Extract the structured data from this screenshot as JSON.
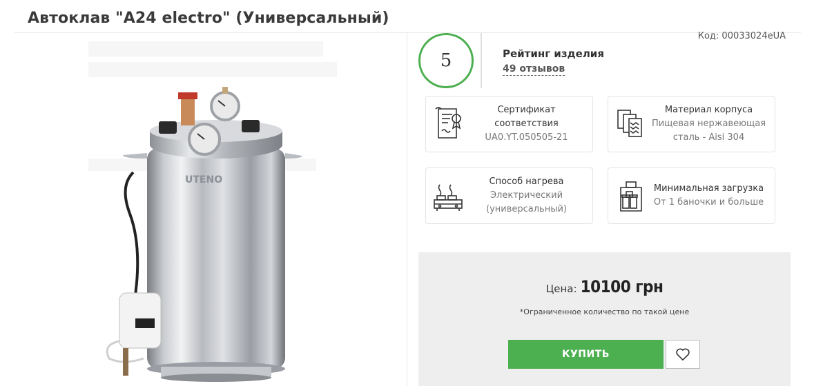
{
  "product": {
    "title": "Автоклав \"A24 electro\" (Универсальный)",
    "code": "Код: 00033024eUA",
    "image_logo_text": "UTENO"
  },
  "rating": {
    "value": "5",
    "title": "Рейтинг изделия",
    "reviews": "49 отзывов"
  },
  "features": [
    {
      "icon": "certificate-icon",
      "label": "Сертификат соответствия",
      "value": "UA0.YT.050505-21"
    },
    {
      "icon": "material-icon",
      "label": "Материал корпуса",
      "value": "Пищевая нержавеющая сталь - Aisi 304"
    },
    {
      "icon": "stove-icon",
      "label": "Способ нагрева",
      "value": "Электрический (универсальный)"
    },
    {
      "icon": "jars-icon",
      "label": "Минимальная загрузка",
      "value": "От 1 баночки и больше"
    }
  ],
  "price": {
    "label": "Цена:",
    "value": "10100 грн",
    "note": "*Ограниченное количество по такой цене",
    "buy_label": "КУПИТЬ"
  },
  "colors": {
    "accent_green": "#4caf50",
    "panel_bg": "#eeeeee"
  }
}
